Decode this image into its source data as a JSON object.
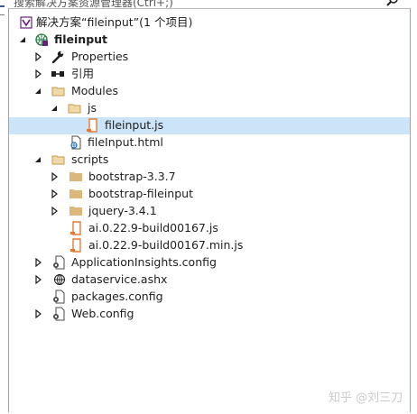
{
  "search": {
    "placeholder": "搜索解决方案资源管理器(Ctrl+;)"
  },
  "tree": {
    "solution": {
      "label": "解决方案“fileinput”(1 个项目)"
    },
    "project": {
      "label": "fileinput"
    },
    "properties": {
      "label": "Properties"
    },
    "references": {
      "label": "引用"
    },
    "modules": {
      "label": "Modules"
    },
    "js_folder": {
      "label": "js"
    },
    "fileinput_js": {
      "label": "fileinput.js"
    },
    "fileinput_html": {
      "label": "fileInput.html"
    },
    "scripts": {
      "label": "scripts"
    },
    "bootstrap": {
      "label": "bootstrap-3.3.7"
    },
    "bootstrap_fileinput": {
      "label": "bootstrap-fileinput"
    },
    "jquery": {
      "label": "jquery-3.4.1"
    },
    "ai_js": {
      "label": "ai.0.22.9-build00167.js"
    },
    "ai_min_js": {
      "label": "ai.0.22.9-build00167.min.js"
    },
    "appinsights": {
      "label": "ApplicationInsights.config"
    },
    "dataservice": {
      "label": "dataservice.ashx"
    },
    "packages": {
      "label": "packages.config"
    },
    "webconfig": {
      "label": "Web.config"
    }
  },
  "selected_item": "fileinput.js",
  "watermark": {
    "text": "知乎 @刘三刀"
  },
  "colors": {
    "selection": "#cce4f7",
    "folder": "#dcb67a",
    "js_file": "#e37933",
    "vs_purple": "#68217a"
  }
}
